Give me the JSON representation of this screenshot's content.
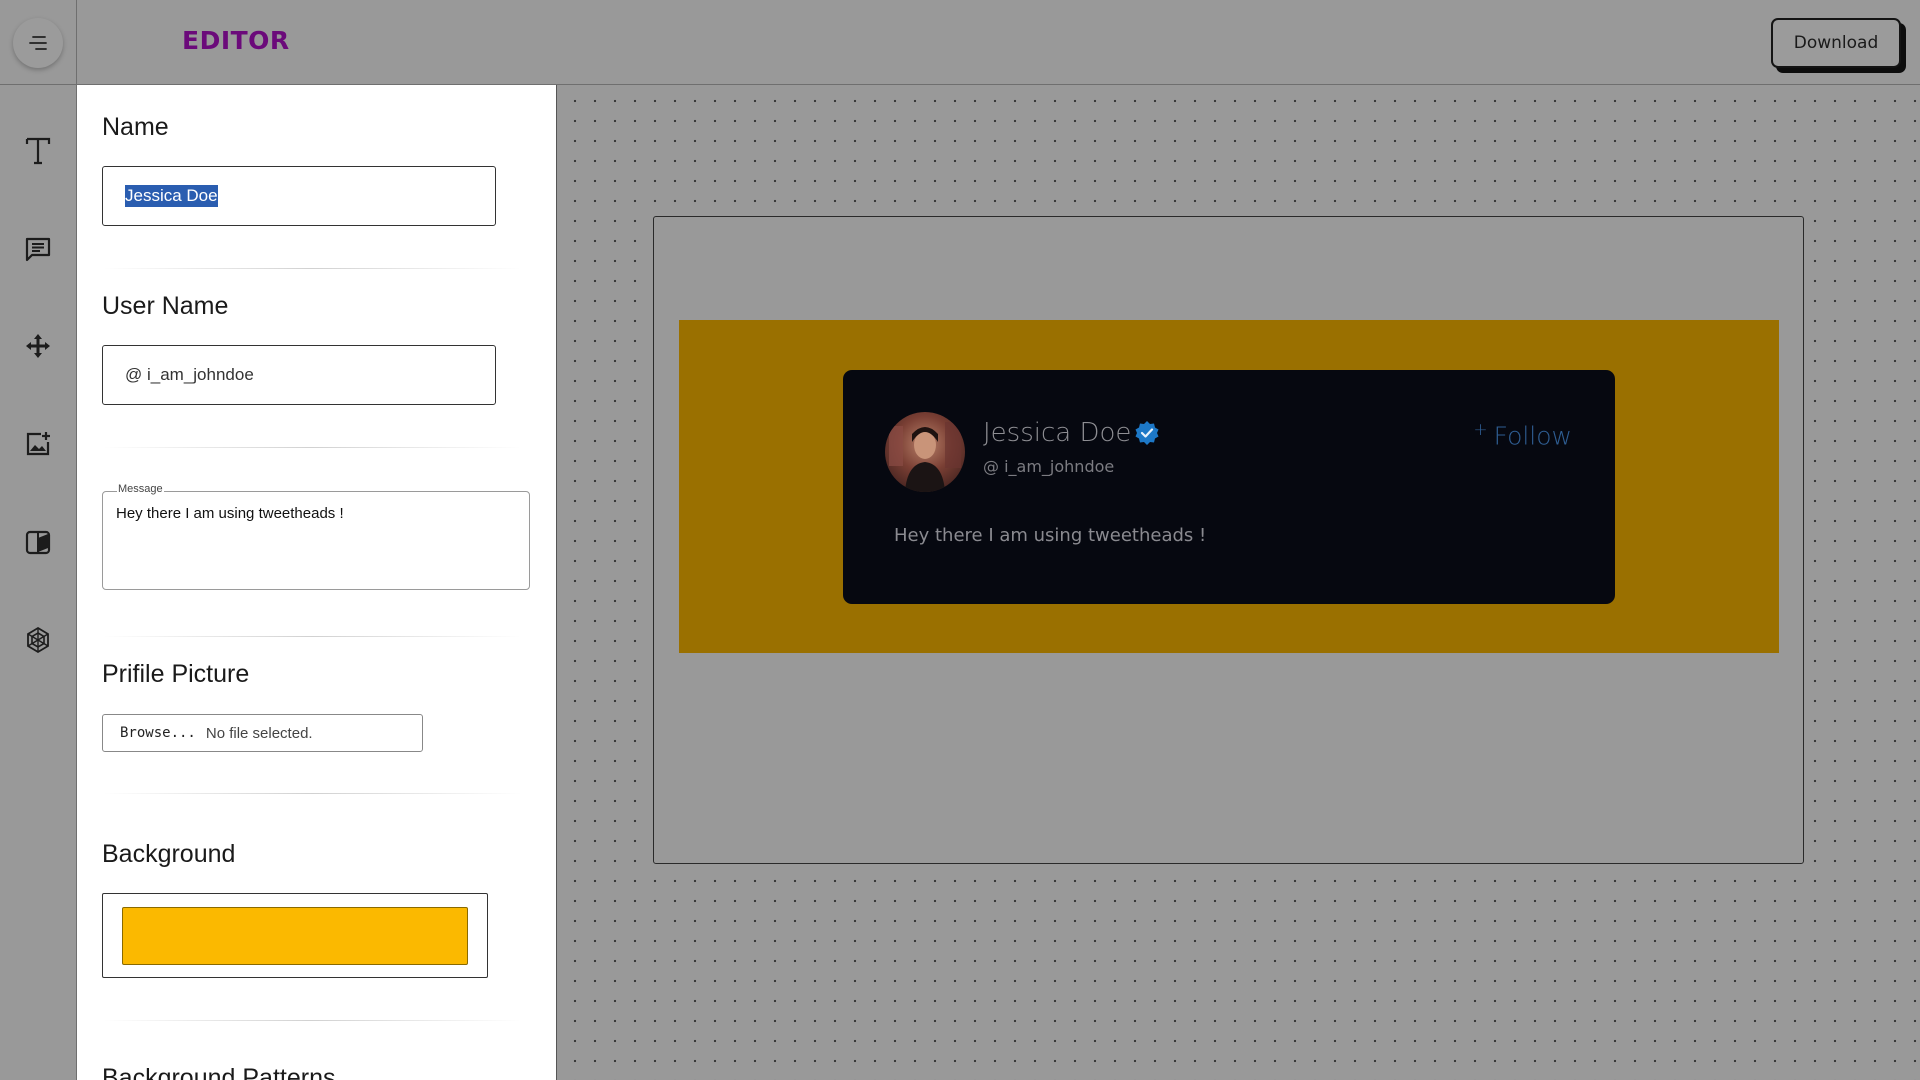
{
  "header": {
    "brand": "EDITOR",
    "download_label": "Download"
  },
  "rail": {
    "items": [
      {
        "name": "text-tool",
        "icon": "text-icon"
      },
      {
        "name": "message-tool",
        "icon": "message-icon"
      },
      {
        "name": "move-tool",
        "icon": "move-icon"
      },
      {
        "name": "image-tool",
        "icon": "add-image-icon"
      },
      {
        "name": "style-tool",
        "icon": "palette-icon"
      },
      {
        "name": "pattern-tool",
        "icon": "pattern-icon"
      }
    ]
  },
  "editor": {
    "name_label": "Name",
    "name_value": "Jessica Doe",
    "username_label": "User Name",
    "username_value": "@ i_am_johndoe",
    "message_legend": "Message",
    "message_value": "Hey there I am using tweetheads !",
    "picture_label": "Prifile Picture",
    "file_button": "Browse...",
    "file_status": "No file selected.",
    "background_label": "Background",
    "background_color": "#fbb900",
    "patterns_label": "Background Patterns"
  },
  "preview": {
    "card_background": "#9a7000",
    "tweet_name": "Jessica Doe",
    "tweet_handle": "@ i_am_johndoe",
    "follow_plus": "+",
    "follow_label": "Follow",
    "tweet_message": "Hey there I am using tweetheads !"
  }
}
